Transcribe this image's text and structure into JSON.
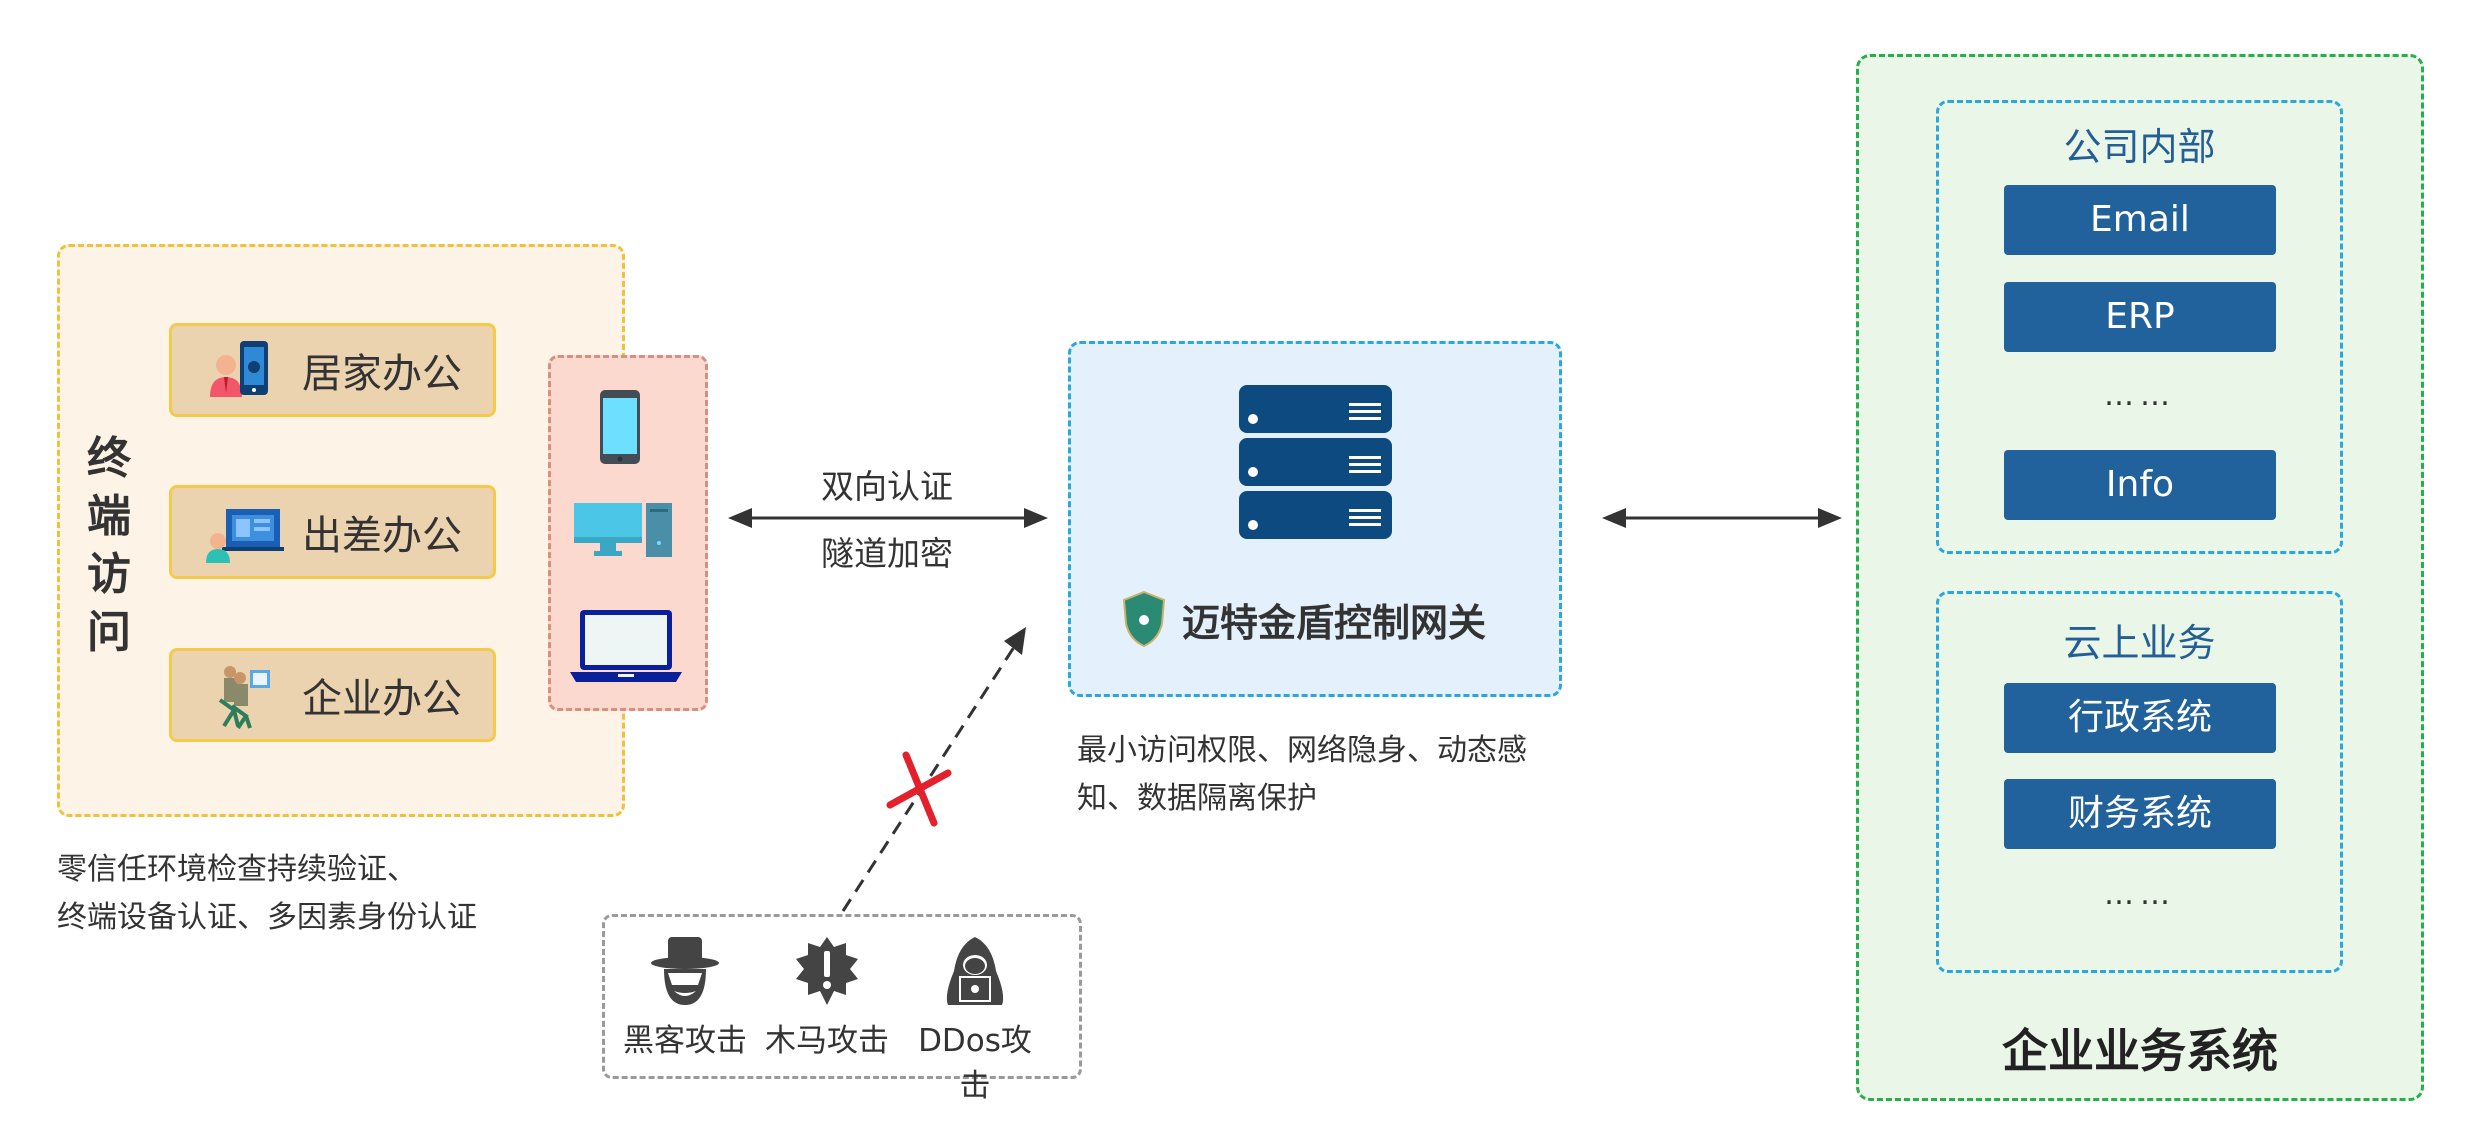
{
  "terminal": {
    "title": "终端访问",
    "scenarios": [
      {
        "label": "居家办公",
        "icon": "person-phone-icon"
      },
      {
        "label": "出差办公",
        "icon": "person-laptop-icon"
      },
      {
        "label": "企业办公",
        "icon": "office-workers-icon"
      }
    ],
    "devices": [
      "smartphone-icon",
      "desktop-computer-icon",
      "laptop-icon"
    ],
    "note_lines": [
      "零信任环境检查持续验证、",
      "终端设备认证、多因素身份认证"
    ]
  },
  "link": {
    "top_label": "双向认证",
    "bottom_label": "隧道加密"
  },
  "gateway": {
    "title": "迈特金盾控制网关",
    "icon": "server-rack-icon",
    "logo": "shield-logo-icon",
    "note_lines": [
      "最小访问权限、网络隐身、动态感",
      "知、数据隔离保护"
    ]
  },
  "attacks": {
    "items": [
      {
        "label": "黑客攻击",
        "icon": "hacker-icon"
      },
      {
        "label": "木马攻击",
        "icon": "trojan-alert-icon"
      },
      {
        "label": "DDos攻击",
        "icon": "hooded-attacker-icon"
      }
    ],
    "blocked_marker": "red-x-icon"
  },
  "enterprise": {
    "title": "企业业务系统",
    "sections": [
      {
        "title": "公司内部",
        "services": [
          "Email",
          "ERP"
        ],
        "ellipsis": "……",
        "last_service": "Info"
      },
      {
        "title": "云上业务",
        "services": [
          "行政系统",
          "财务系统"
        ],
        "ellipsis": "……"
      }
    ]
  },
  "colors": {
    "terminal_border": "#f0c23a",
    "gateway_border": "#2aa7dd",
    "enterprise_border": "#27ae4e",
    "service_fill": "#21629d",
    "server_fill": "#0d4a80",
    "blocked": "#e5202d"
  }
}
